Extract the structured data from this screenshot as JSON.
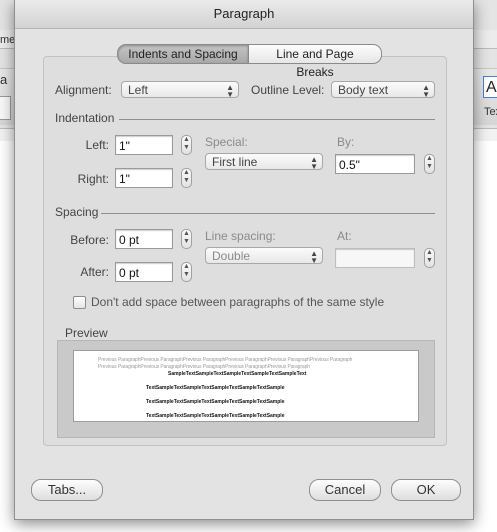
{
  "background": {
    "left_fragment_top": "me",
    "left_fragment_mid": "a",
    "right_fragment_box": "A",
    "right_fragment_text": "Tex"
  },
  "dialog": {
    "title": "Paragraph",
    "tabs": [
      {
        "label": "Indents and Spacing",
        "selected": true
      },
      {
        "label": "Line and Page Breaks",
        "selected": false
      }
    ],
    "alignment": {
      "label": "Alignment:",
      "value": "Left"
    },
    "outline_level": {
      "label": "Outline Level:",
      "value": "Body text"
    },
    "indentation": {
      "heading": "Indentation",
      "left_label": "Left:",
      "left_value": "1\"",
      "right_label": "Right:",
      "right_value": "1\"",
      "special_label": "Special:",
      "special_value": "First line",
      "by_label": "By:",
      "by_value": "0.5\""
    },
    "spacing": {
      "heading": "Spacing",
      "before_label": "Before:",
      "before_value": "0 pt",
      "after_label": "After:",
      "after_value": "0 pt",
      "line_spacing_label": "Line spacing:",
      "line_spacing_value": "Double",
      "at_label": "At:",
      "at_value": ""
    },
    "checkbox": {
      "label": "Don't add space between paragraphs of the same style",
      "checked": false
    },
    "preview": {
      "heading": "Preview",
      "previous_line_1": "Previous ParagraphPrevious ParagraphPrevious ParagraphPrevious ParagraphPrevious ParagraphPrevious Paragraph",
      "previous_line_2": "Previous ParagraphPrevious ParagraphPrevious ParagraphPrevious ParagraphPrevious Paragraph",
      "sample_line_1": "SampleTextSampleTextSampleTextSampleTextSampleText",
      "sample_line_2": "TextSampleTextSampleTextSampleTextSampleTextSample",
      "sample_line_3": "TextSampleTextSampleTextSampleTextSampleTextSample",
      "sample_line_4": "TextSampleTextSampleTextSampleTextSampleTextSample"
    },
    "buttons": {
      "tabs": "Tabs...",
      "cancel": "Cancel",
      "ok": "OK"
    }
  },
  "colors": {
    "dialog_bg": "#e3e3e3",
    "panel_bg": "#dedede",
    "selected_tab": "#b5b5b5"
  }
}
